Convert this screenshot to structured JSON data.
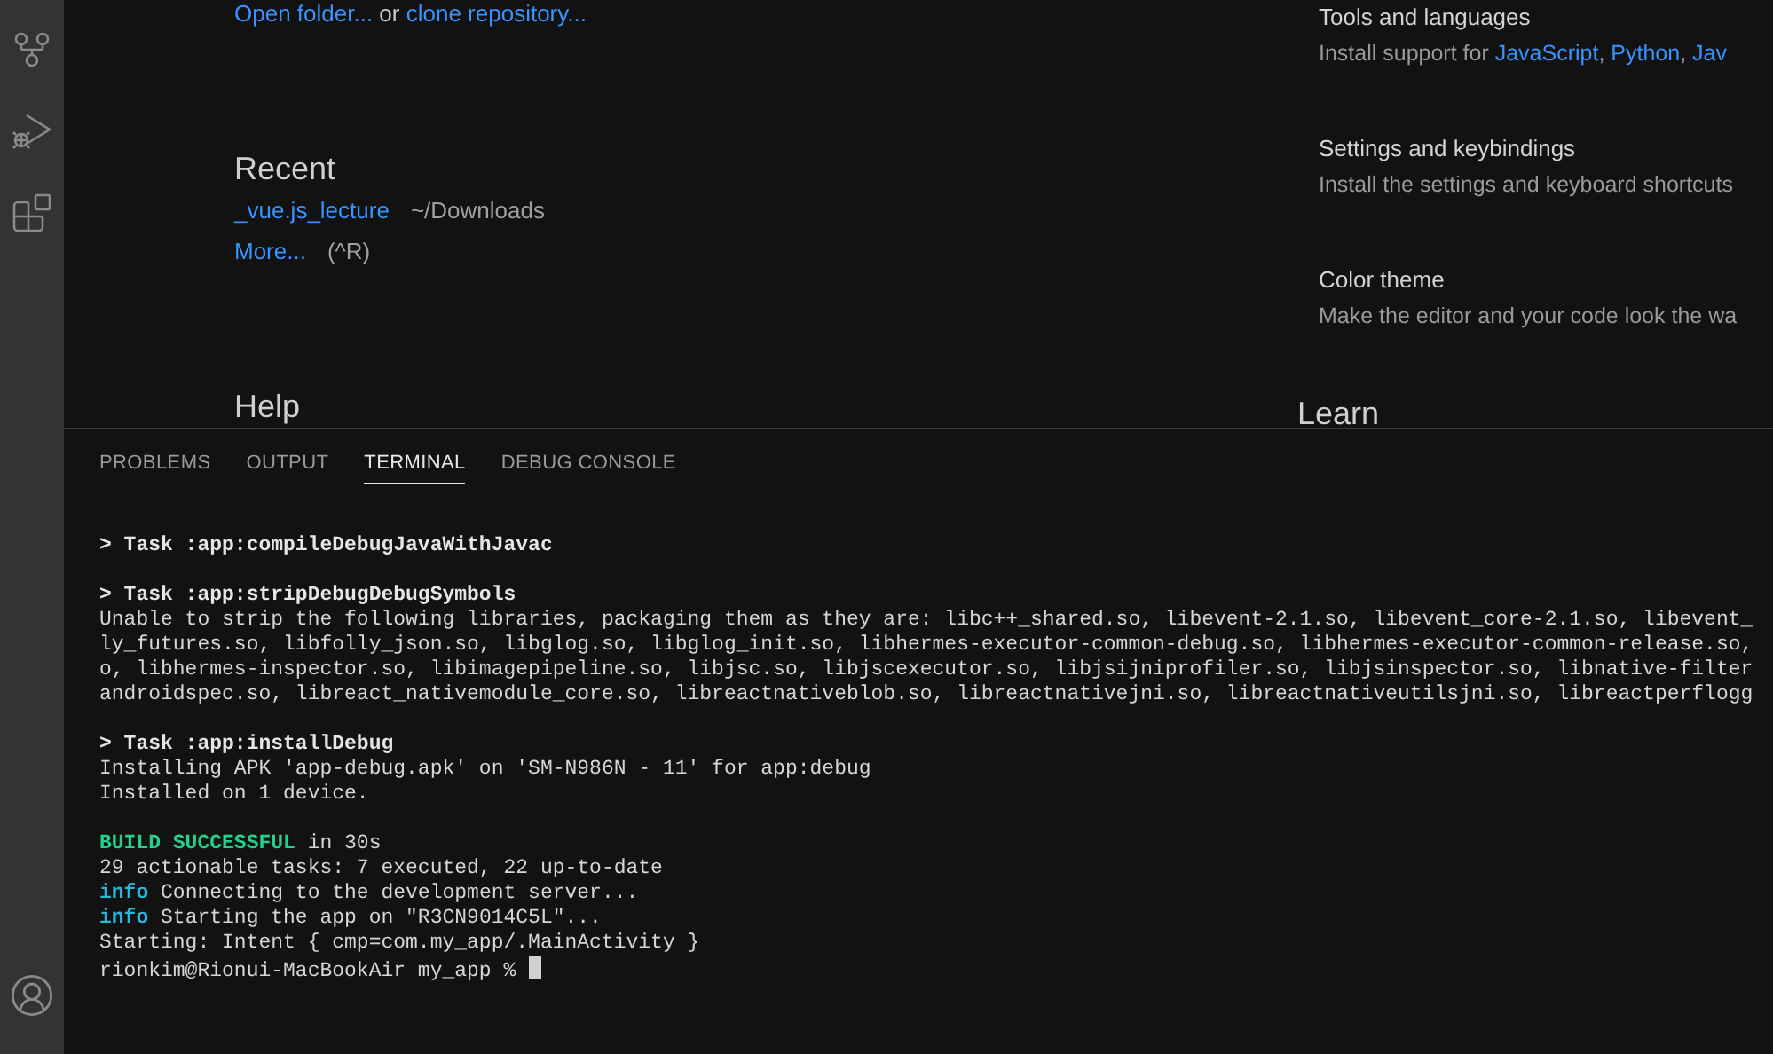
{
  "activity_bar": {
    "items": [
      {
        "kind": "source-control"
      },
      {
        "kind": "run-debug"
      },
      {
        "kind": "extensions"
      }
    ],
    "account": {
      "kind": "account"
    }
  },
  "welcome": {
    "left": {
      "start_line": [
        {
          "text": "Open folder...",
          "kind": "link"
        },
        {
          "text": " or ",
          "kind": "plain"
        },
        {
          "text": "clone repository...",
          "kind": "link"
        }
      ],
      "recent": {
        "heading": "Recent",
        "items": [
          {
            "name": "_vue.js_lecture",
            "path": "~/Downloads"
          }
        ],
        "more": {
          "label": "More...",
          "shortcut": "(^R)"
        }
      },
      "help": {
        "heading": "Help"
      }
    },
    "right": {
      "items": [
        {
          "title": "Tools and languages",
          "description": [
            {
              "text": "Install support for ",
              "kind": "plain"
            },
            {
              "text": "JavaScript",
              "kind": "link"
            },
            {
              "text": ", ",
              "kind": "plain"
            },
            {
              "text": "Python",
              "kind": "link"
            },
            {
              "text": ", ",
              "kind": "plain"
            },
            {
              "text": "Jav",
              "kind": "link"
            }
          ]
        },
        {
          "title": "Settings and keybindings",
          "description": [
            {
              "text": "Install the settings and keyboard shortcuts",
              "kind": "plain"
            }
          ]
        },
        {
          "title": "Color theme",
          "description": [
            {
              "text": "Make the editor and your code look the wa",
              "kind": "plain"
            }
          ]
        }
      ],
      "learn": {
        "heading": "Learn"
      }
    }
  },
  "panel": {
    "tabs": [
      {
        "label": "PROBLEMS",
        "selected": false
      },
      {
        "label": "OUTPUT",
        "selected": false
      },
      {
        "label": "TERMINAL",
        "selected": true
      },
      {
        "label": "DEBUG CONSOLE",
        "selected": false
      }
    ],
    "terminal": {
      "blocks": [
        [
          [
            {
              "text": "> Task :app:compileDebugJavaWithJavac",
              "kind": "bold"
            }
          ]
        ],
        [
          [
            {
              "text": "> Task :app:stripDebugDebugSymbols",
              "kind": "bold"
            }
          ],
          [
            {
              "text": "Unable to strip the following libraries, packaging them as they are: libc++_shared.so, libevent-2.1.so, libevent_core-2.1.so, libevent_",
              "kind": "plain"
            }
          ],
          [
            {
              "text": "ly_futures.so, libfolly_json.so, libglog.so, libglog_init.so, libhermes-executor-common-debug.so, libhermes-executor-common-release.so,",
              "kind": "plain"
            }
          ],
          [
            {
              "text": "o, libhermes-inspector.so, libimagepipeline.so, libjsc.so, libjscexecutor.so, libjsijniprofiler.so, libjsinspector.so, libnative-filter",
              "kind": "plain"
            }
          ],
          [
            {
              "text": "androidspec.so, libreact_nativemodule_core.so, libreactnativeblob.so, libreactnativejni.so, libreactnativeutilsjni.so, libreactperflogg",
              "kind": "plain"
            }
          ]
        ],
        [
          [
            {
              "text": "> Task :app:installDebug",
              "kind": "bold"
            }
          ],
          [
            {
              "text": "Installing APK 'app-debug.apk' on 'SM-N986N - 11' for app:debug",
              "kind": "plain"
            }
          ],
          [
            {
              "text": "Installed on 1 device.",
              "kind": "plain"
            }
          ]
        ],
        [
          [
            {
              "text": "BUILD SUCCESSFUL",
              "kind": "success"
            },
            {
              "text": " in 30s",
              "kind": "plain"
            }
          ],
          [
            {
              "text": "29 actionable tasks: 7 executed, 22 up-to-date",
              "kind": "plain"
            }
          ],
          [
            {
              "text": "info",
              "kind": "info"
            },
            {
              "text": " Connecting to the development server...",
              "kind": "plain"
            }
          ],
          [
            {
              "text": "info",
              "kind": "info"
            },
            {
              "text": " Starting the app on \"R3CN9014C5L\"...",
              "kind": "plain"
            }
          ],
          [
            {
              "text": "Starting: Intent { cmp=com.my_app/.MainActivity }",
              "kind": "plain"
            }
          ],
          [
            {
              "text": "rionkim@Rionui-MacBookAir my_app % ",
              "kind": "plain"
            }
          ]
        ]
      ],
      "cursor": true
    }
  }
}
